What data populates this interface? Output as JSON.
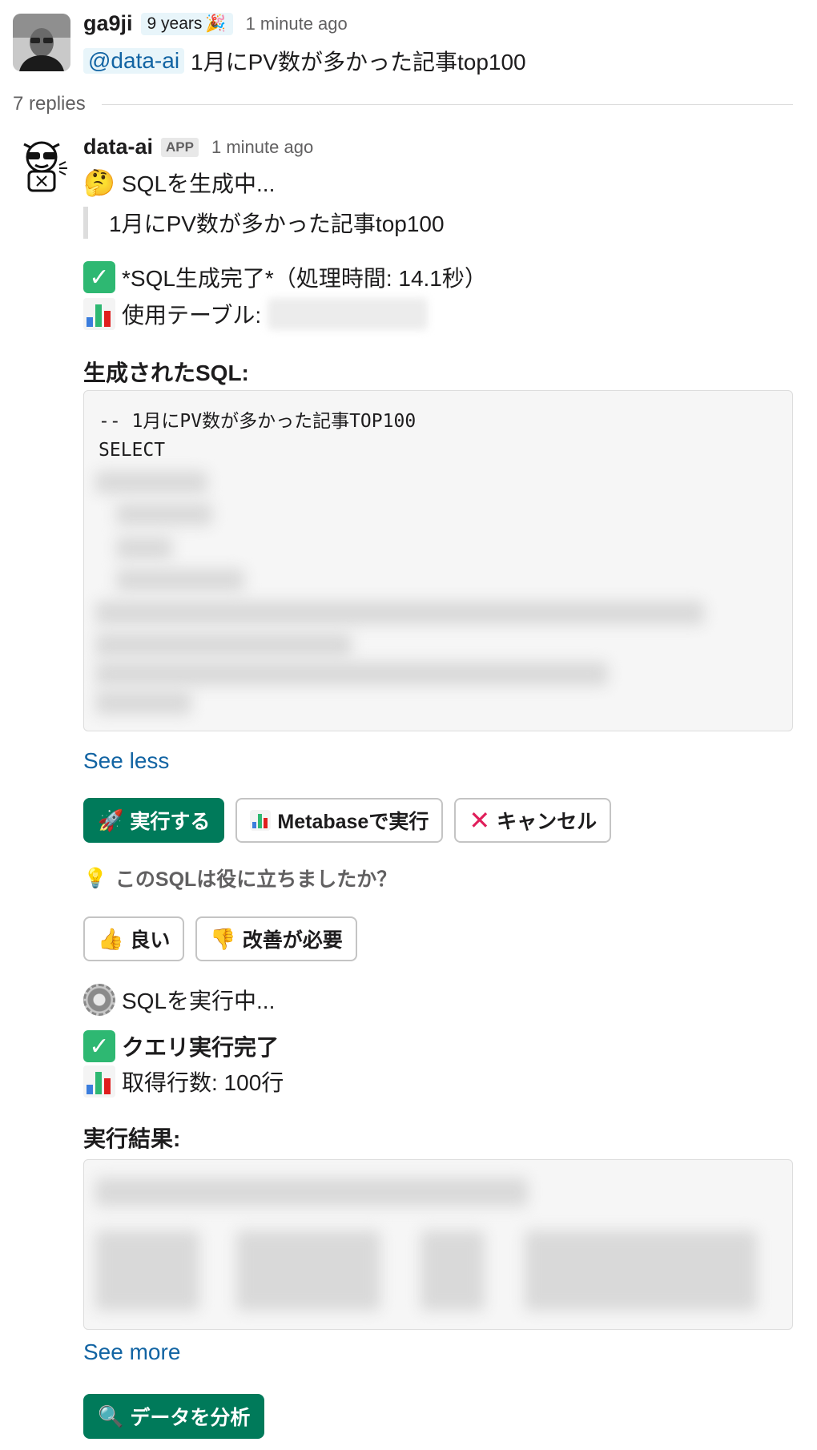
{
  "parent_message": {
    "username": "ga9ji",
    "years_badge": "9 years",
    "years_badge_icon": "party-popper-icon",
    "timestamp": "1 minute ago",
    "mention": "@data-ai",
    "text": "1月にPV数が多かった記事top100"
  },
  "thread": {
    "replies_label": "7 replies"
  },
  "bot_message": {
    "username": "data-ai",
    "app_badge": "APP",
    "timestamp": "1 minute ago",
    "status_generating": "SQLを生成中...",
    "quoted_request": "1月にPV数が多かった記事top100",
    "status_done": "*SQL生成完了*（処理時間: 14.1秒）",
    "table_label": "使用テーブル:",
    "generated_sql_title": "生成されたSQL:",
    "sql_lines": [
      "-- 1月にPV数が多かった記事TOP100",
      "SELECT"
    ],
    "see_less": "See less",
    "buttons": {
      "execute": "実行する",
      "metabase": "Metabaseで実行",
      "cancel": "キャンセル"
    },
    "feedback_question": "このSQLは役に立ちましたか？",
    "feedback_buttons": {
      "good": "良い",
      "needs_improvement": "改善が必要"
    },
    "status_executing": "SQLを実行中...",
    "query_done": "クエリ実行完了",
    "rows_fetched": "取得行数: 100行",
    "results_title": "実行結果:",
    "see_more": "See more",
    "analyze_button": "データを分析"
  },
  "colors": {
    "accent_green": "#007a5a",
    "link_blue": "#1264a3",
    "check_green": "#2eb872",
    "cancel_red": "#e01e5a"
  }
}
